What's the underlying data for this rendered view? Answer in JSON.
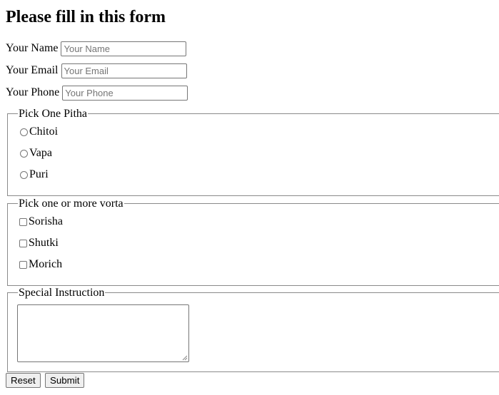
{
  "form": {
    "title": "Please fill in this form",
    "fields": [
      {
        "label": "Your Name",
        "placeholder": "Your Name",
        "value": ""
      },
      {
        "label": "Your Email",
        "placeholder": "Your Email",
        "value": ""
      },
      {
        "label": "Your Phone",
        "placeholder": "Your Phone",
        "value": ""
      }
    ],
    "pitha": {
      "legend": "Pick One Pitha",
      "options": [
        "Chitoi",
        "Vapa",
        "Puri"
      ]
    },
    "vorta": {
      "legend": "Pick one or more vorta",
      "options": [
        "Sorisha",
        "Shutki",
        "Morich"
      ]
    },
    "instruction": {
      "legend": "Special Instruction",
      "value": ""
    },
    "buttons": {
      "reset": "Reset",
      "submit": "Submit"
    }
  }
}
